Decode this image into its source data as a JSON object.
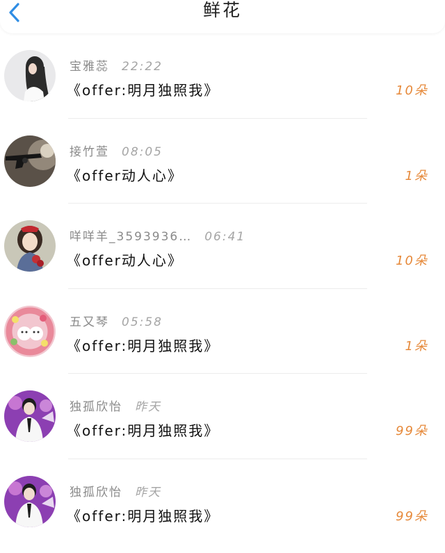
{
  "header": {
    "title": "鲜花"
  },
  "colors": {
    "accent": "#2f8de4",
    "flower_count": "#e6893a"
  },
  "records": [
    {
      "name": "宝雅蕊",
      "time": "22:22",
      "book": "《offer:明月独照我》",
      "count": "10朵"
    },
    {
      "name": "接竹萱",
      "time": "08:05",
      "book": "《offer动人心》",
      "count": "1朵"
    },
    {
      "name": "咩咩羊_3593936…",
      "time": "06:41",
      "book": "《offer动人心》",
      "count": "10朵"
    },
    {
      "name": "五又琴",
      "time": "05:58",
      "book": "《offer:明月独照我》",
      "count": "1朵"
    },
    {
      "name": "独孤欣怡",
      "time": "昨天",
      "book": "《offer:明月独照我》",
      "count": "99朵"
    },
    {
      "name": "独孤欣怡",
      "time": "昨天",
      "book": "《offer:明月独照我》",
      "count": "99朵"
    }
  ]
}
